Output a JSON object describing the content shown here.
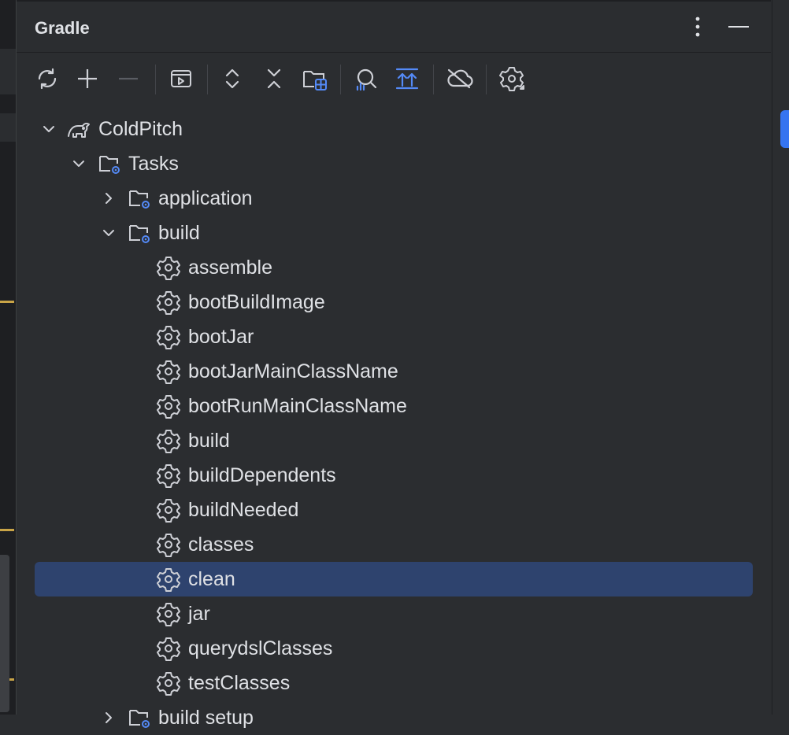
{
  "panel": {
    "title": "Gradle"
  },
  "header_buttons": [
    {
      "name": "more-options-icon"
    },
    {
      "name": "minimize-icon"
    }
  ],
  "toolbar": [
    {
      "name": "reload-icon"
    },
    {
      "name": "add-icon"
    },
    {
      "name": "remove-icon"
    },
    {
      "name": "run-configurations-icon"
    },
    {
      "name": "expand-all-icon"
    },
    {
      "name": "collapse-all-icon"
    },
    {
      "name": "dependencies-icon"
    },
    {
      "name": "analyze-dependencies-icon"
    },
    {
      "name": "show-dependency-changes-icon"
    },
    {
      "name": "offline-mode-icon"
    },
    {
      "name": "settings-icon"
    }
  ],
  "tree": {
    "project": "ColdPitch",
    "tasks_folder": "Tasks",
    "groups": [
      {
        "label": "application",
        "expanded": false
      },
      {
        "label": "build",
        "expanded": true
      }
    ],
    "build_tasks": [
      "assemble",
      "bootBuildImage",
      "bootJar",
      "bootJarMainClassName",
      "bootRunMainClassName",
      "build",
      "buildDependents",
      "buildNeeded",
      "classes",
      "clean",
      "jar",
      "querydslClasses",
      "testClasses"
    ],
    "selected_task": "clean",
    "next_group": "build setup"
  },
  "colors": {
    "background": "#2b2d30",
    "selection": "#2e436e",
    "accent": "#3574f0",
    "text": "#dfe1e5"
  }
}
